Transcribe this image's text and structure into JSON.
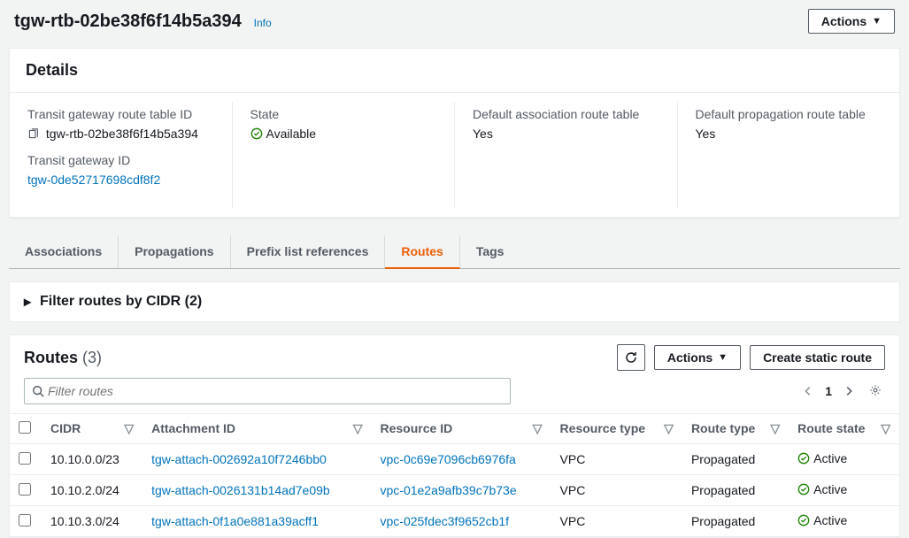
{
  "header": {
    "title": "tgw-rtb-02be38f6f14b5a394",
    "info_label": "Info",
    "actions_label": "Actions"
  },
  "details": {
    "title": "Details",
    "col1": {
      "route_table_id_label": "Transit gateway route table ID",
      "route_table_id_value": "tgw-rtb-02be38f6f14b5a394",
      "tgw_id_label": "Transit gateway ID",
      "tgw_id_value": "tgw-0de52717698cdf8f2"
    },
    "col2": {
      "state_label": "State",
      "state_value": "Available"
    },
    "col3": {
      "assoc_label": "Default association route table",
      "assoc_value": "Yes"
    },
    "col4": {
      "prop_label": "Default propagation route table",
      "prop_value": "Yes"
    }
  },
  "tabs": {
    "associations": "Associations",
    "propagations": "Propagations",
    "prefix": "Prefix list references",
    "routes": "Routes",
    "tags": "Tags"
  },
  "expander": {
    "title": "Filter routes by CIDR (2)"
  },
  "routes": {
    "title": "Routes",
    "count": "(3)",
    "actions_label": "Actions",
    "create_label": "Create static route",
    "filter_placeholder": "Filter routes",
    "page": "1",
    "cols": {
      "cidr": "CIDR",
      "attachment": "Attachment ID",
      "resource": "Resource ID",
      "restype": "Resource type",
      "routetype": "Route type",
      "routestate": "Route state"
    },
    "rows": [
      {
        "cidr": "10.10.0.0/23",
        "attachment": "tgw-attach-002692a10f7246bb0",
        "resource": "vpc-0c69e7096cb6976fa",
        "restype": "VPC",
        "routetype": "Propagated",
        "state": "Active"
      },
      {
        "cidr": "10.10.2.0/24",
        "attachment": "tgw-attach-0026131b14ad7e09b",
        "resource": "vpc-01e2a9afb39c7b73e",
        "restype": "VPC",
        "routetype": "Propagated",
        "state": "Active"
      },
      {
        "cidr": "10.10.3.0/24",
        "attachment": "tgw-attach-0f1a0e881a39acff1",
        "resource": "vpc-025fdec3f9652cb1f",
        "restype": "VPC",
        "routetype": "Propagated",
        "state": "Active"
      }
    ]
  }
}
